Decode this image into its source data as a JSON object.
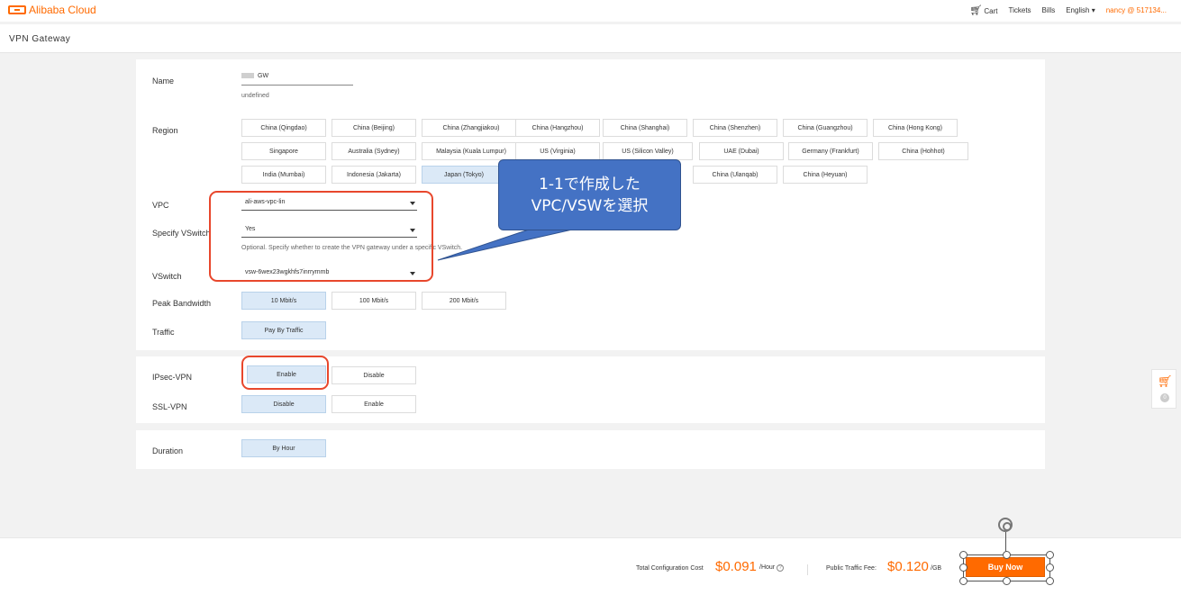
{
  "topbar": {
    "logo": "Alibaba Cloud",
    "cart": "Cart",
    "tickets": "Tickets",
    "bills": "Bills",
    "language": "English",
    "user": "nancy @ 517134..."
  },
  "page_title": "VPN Gateway",
  "form": {
    "name": {
      "label": "Name",
      "value": "GW",
      "hint": "undefined"
    },
    "region": {
      "label": "Region",
      "selected": "Japan (Tokyo)",
      "options": [
        "China (Qingdao)",
        "China (Beijing)",
        "China (Zhangjiakou)",
        "China (Hangzhou)",
        "China (Shanghai)",
        "China (Shenzhen)",
        "China (Guangzhou)",
        "China (Hong Kong)",
        "Singapore",
        "Australia (Sydney)",
        "Malaysia (Kuala Lumpur)",
        "US (Virginia)",
        "US (Silicon Valley)",
        "UAE (Dubai)",
        "Germany (Frankfurt)",
        "China (Hohhot)",
        "India (Mumbai)",
        "Indonesia (Jakarta)",
        "Japan (Tokyo)",
        "China (Ulanqab)",
        "China (Heyuan)"
      ]
    },
    "vpc": {
      "label": "VPC",
      "value": "ali-aws-vpc-lin"
    },
    "specify_vswitch": {
      "label": "Specify VSwitch",
      "value": "Yes",
      "hint": "Optional. Specify whether to create the VPN gateway under a specific VSwitch."
    },
    "vswitch": {
      "label": "VSwitch",
      "value": "vsw-6wex23wgkhfs7inrrymmb"
    },
    "peak_bandwidth": {
      "label": "Peak Bandwidth",
      "options": [
        "10 Mbit/s",
        "100 Mbit/s",
        "200 Mbit/s"
      ],
      "selected": "10 Mbit/s"
    },
    "traffic": {
      "label": "Traffic",
      "options": [
        "Pay By Traffic"
      ],
      "selected": "Pay By Traffic"
    },
    "ipsec_vpn": {
      "label": "IPsec-VPN",
      "options": [
        "Enable",
        "Disable"
      ],
      "selected": "Enable"
    },
    "ssl_vpn": {
      "label": "SSL-VPN",
      "options": [
        "Disable",
        "Enable"
      ],
      "selected": "Disable"
    },
    "duration": {
      "label": "Duration",
      "options": [
        "By Hour"
      ],
      "selected": "By Hour"
    }
  },
  "callout": {
    "line1": "1-1で作成した",
    "line2": "VPC/VSWを選択"
  },
  "footer": {
    "total_label": "Total Configuration Cost",
    "total_price": "$0.091",
    "total_unit": "/Hour",
    "traffic_label": "Public Traffic Fee:",
    "traffic_price": "$0.120",
    "traffic_unit": "/GB",
    "buy_label": "Buy Now"
  },
  "side_cart": {
    "count": "0"
  },
  "colors": {
    "accent": "#ff6a00",
    "selected_bg": "#dbe9f7",
    "annotation_red": "#e8472c",
    "callout_blue": "#4472c4"
  }
}
